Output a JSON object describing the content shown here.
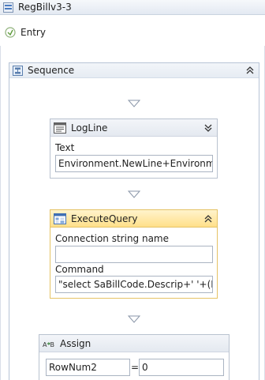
{
  "window": {
    "title": "RegBillv3-3"
  },
  "entry": {
    "label": "Entry"
  },
  "sequence": {
    "title": "Sequence"
  },
  "activities": {
    "logline": {
      "title": "LogLine",
      "text_label": "Text",
      "text_value": "Environment.NewLine+Environmen"
    },
    "executequery": {
      "title": "ExecuteQuery",
      "connection_label": "Connection string name",
      "connection_value": "",
      "command_label": "Command",
      "command_value": "\"select SaBillCode.Descrip+'  '+(Per"
    },
    "assign": {
      "title": "Assign",
      "to_value": "RowNum2",
      "equals": "=",
      "value_value": "0"
    }
  },
  "colors": {
    "selected_header": "#ffe08a",
    "border": "#b9c2cf"
  }
}
